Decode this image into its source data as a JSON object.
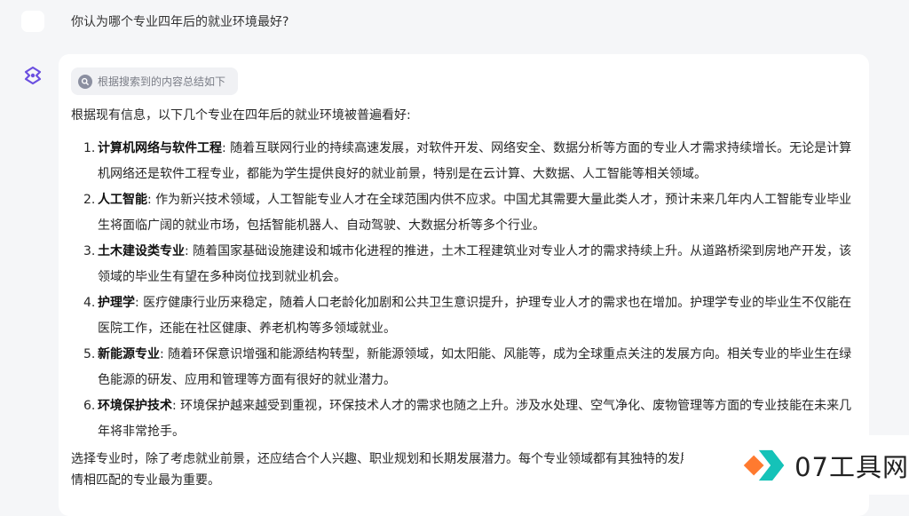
{
  "user": {
    "question": "你认为哪个专业四年后的就业环境最好?"
  },
  "answer": {
    "source_chip": "根据搜索到的内容总结如下",
    "intro": "根据现有信息，以下几个专业在四年后的就业环境被普遍看好:",
    "items": [
      {
        "num": "1.",
        "title": "计算机网络与软件工程",
        "text": ": 随着互联网行业的持续高速发展，对软件开发、网络安全、数据分析等方面的专业人才需求持续增长。无论是计算机网络还是软件工程专业，都能为学生提供良好的就业前景，特别是在云计算、大数据、人工智能等相关领域。"
      },
      {
        "num": "2.",
        "title": "人工智能",
        "text": ": 作为新兴技术领域，人工智能专业人才在全球范围内供不应求。中国尤其需要大量此类人才，预计未来几年内人工智能专业毕业生将面临广阔的就业市场，包括智能机器人、自动驾驶、大数据分析等多个行业。"
      },
      {
        "num": "3.",
        "title": "土木建设类专业",
        "text": ": 随着国家基础设施建设和城市化进程的推进，土木工程建筑业对专业人才的需求持续上升。从道路桥梁到房地产开发，该领域的毕业生有望在多种岗位找到就业机会。"
      },
      {
        "num": "4.",
        "title": "护理学",
        "text": ": 医疗健康行业历来稳定，随着人口老龄化加剧和公共卫生意识提升，护理专业人才的需求也在增加。护理学专业的毕业生不仅能在医院工作，还能在社区健康、养老机构等多领域就业。"
      },
      {
        "num": "5.",
        "title": "新能源专业",
        "text": ": 随着环保意识增强和能源结构转型，新能源领域，如太阳能、风能等，成为全球重点关注的发展方向。相关专业的毕业生在绿色能源的研发、应用和管理等方面有很好的就业潜力。"
      },
      {
        "num": "6.",
        "title": "环境保护技术",
        "text": ": 环境保护越来越受到重视，环保技术人才的需求也随之上升。涉及水处理、空气净化、废物管理等方面的专业技能在未来几年将非常抢手。"
      }
    ],
    "outro": "选择专业时，除了考虑就业前景，还应结合个人兴趣、职业规划和长期发展潜力。每个专业领域都有其独特的发展路径，选择与个人优势和激情相匹配的专业最为重要。"
  },
  "watermark": {
    "text": "07工具网"
  },
  "colors": {
    "page_background": "#f5f6f8",
    "card_background": "#ffffff",
    "ai_avatar_purple": "#6b4fe0",
    "watermark_orange": "#ff7a2f",
    "watermark_teal": "#15c2b8"
  }
}
